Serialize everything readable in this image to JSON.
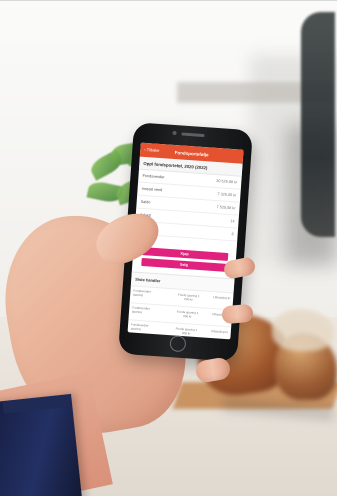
{
  "phone_app": {
    "header_title": "Fondsportefølje",
    "back_label": "Tilbake",
    "subtitle": "Oppl fondsporteføl, 2020 (2022)",
    "details": [
      {
        "label": "Fondsverdier",
        "value": "30 525,08 kr"
      },
      {
        "label": "Innsatt verdi",
        "value": "7 325,00 kr"
      },
      {
        "label": "Saldo",
        "value": "7 525,08 kr"
      },
      {
        "label": "Avkast",
        "value": "14"
      },
      {
        "label": "",
        "value": "6"
      }
    ],
    "buttons": [
      {
        "label": "Kjøp"
      },
      {
        "label": "Selg"
      }
    ],
    "section_title": "Siste handler",
    "transactions": [
      {
        "left": "Fondsverdier sparing",
        "middle": "Fonds sparing 1 000 kr",
        "right": "Utbetaling kr"
      },
      {
        "left": "Fondsverdier sparing",
        "middle": "Fonds sparing 1 000 kr",
        "right": "Utbetaling kr"
      },
      {
        "left": "Fondsverdier sparing",
        "middle": "Fonds sparing 1 000 kr",
        "right": "Utbetaling kr"
      }
    ]
  },
  "colors": {
    "accent": "#e5522f",
    "button": "#e0217d",
    "sleeve": "#1f2a55"
  }
}
